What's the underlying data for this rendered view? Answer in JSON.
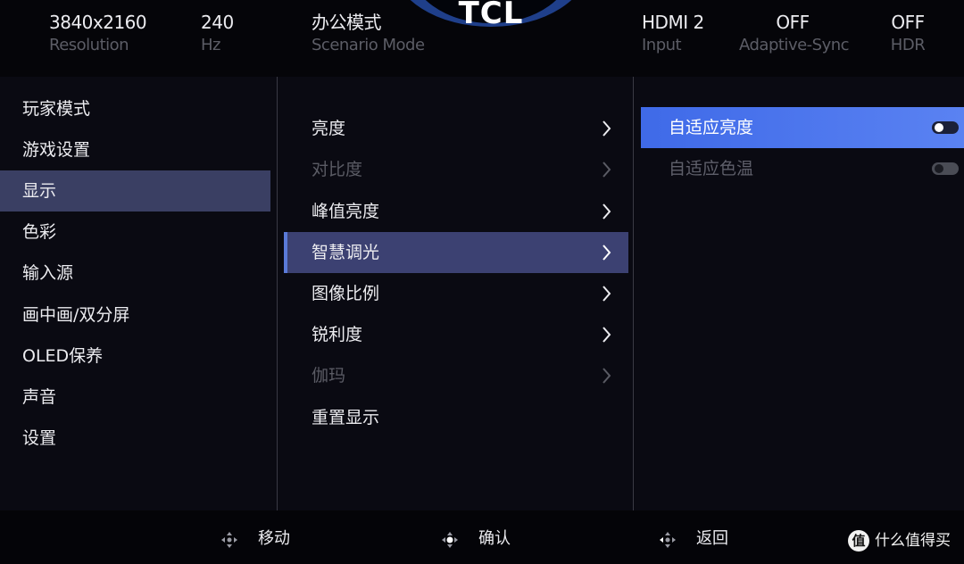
{
  "status": {
    "resolution": {
      "value": "3840x2160",
      "caption": "Resolution"
    },
    "refresh": {
      "value": "240",
      "caption": "Hz"
    },
    "scenario": {
      "value": "办公模式",
      "caption": "Scenario Mode"
    },
    "input": {
      "value": "HDMI 2",
      "caption": "Input"
    },
    "adaptive_sync": {
      "value": "OFF",
      "caption": "Adaptive-Sync"
    },
    "hdr": {
      "value": "OFF",
      "caption": "HDR"
    },
    "brand": "TCL"
  },
  "main_menu": {
    "items": [
      {
        "label": "玩家模式",
        "selected": false
      },
      {
        "label": "游戏设置",
        "selected": false
      },
      {
        "label": "显示",
        "selected": true
      },
      {
        "label": "色彩",
        "selected": false
      },
      {
        "label": "输入源",
        "selected": false
      },
      {
        "label": "画中画/双分屏",
        "selected": false
      },
      {
        "label": "OLED保养",
        "selected": false
      },
      {
        "label": "声音",
        "selected": false
      },
      {
        "label": "设置",
        "selected": false
      }
    ]
  },
  "sub_menu": {
    "items": [
      {
        "label": "亮度",
        "state": "enabled",
        "has_submenu": true
      },
      {
        "label": "对比度",
        "state": "disabled",
        "has_submenu": true
      },
      {
        "label": "峰值亮度",
        "state": "enabled",
        "has_submenu": true
      },
      {
        "label": "智慧调光",
        "state": "selected",
        "has_submenu": true
      },
      {
        "label": "图像比例",
        "state": "enabled",
        "has_submenu": true
      },
      {
        "label": "锐利度",
        "state": "enabled",
        "has_submenu": true
      },
      {
        "label": "伽玛",
        "state": "disabled",
        "has_submenu": true
      },
      {
        "label": "重置显示",
        "state": "enabled",
        "has_submenu": false
      }
    ]
  },
  "options": {
    "items": [
      {
        "label": "自适应亮度",
        "selected": true,
        "toggle": "on"
      },
      {
        "label": "自适应色温",
        "selected": false,
        "toggle": "off"
      }
    ]
  },
  "hints": {
    "move": "移动",
    "confirm": "确认",
    "back": "返回"
  },
  "watermark": {
    "icon_glyph": "值",
    "text": "什么值得买"
  },
  "colors": {
    "selected_main": "#3a3f63",
    "selected_sub": "#3c4172",
    "selected_option": "#4a76ee",
    "logo_ring": "#1f3f8a"
  }
}
